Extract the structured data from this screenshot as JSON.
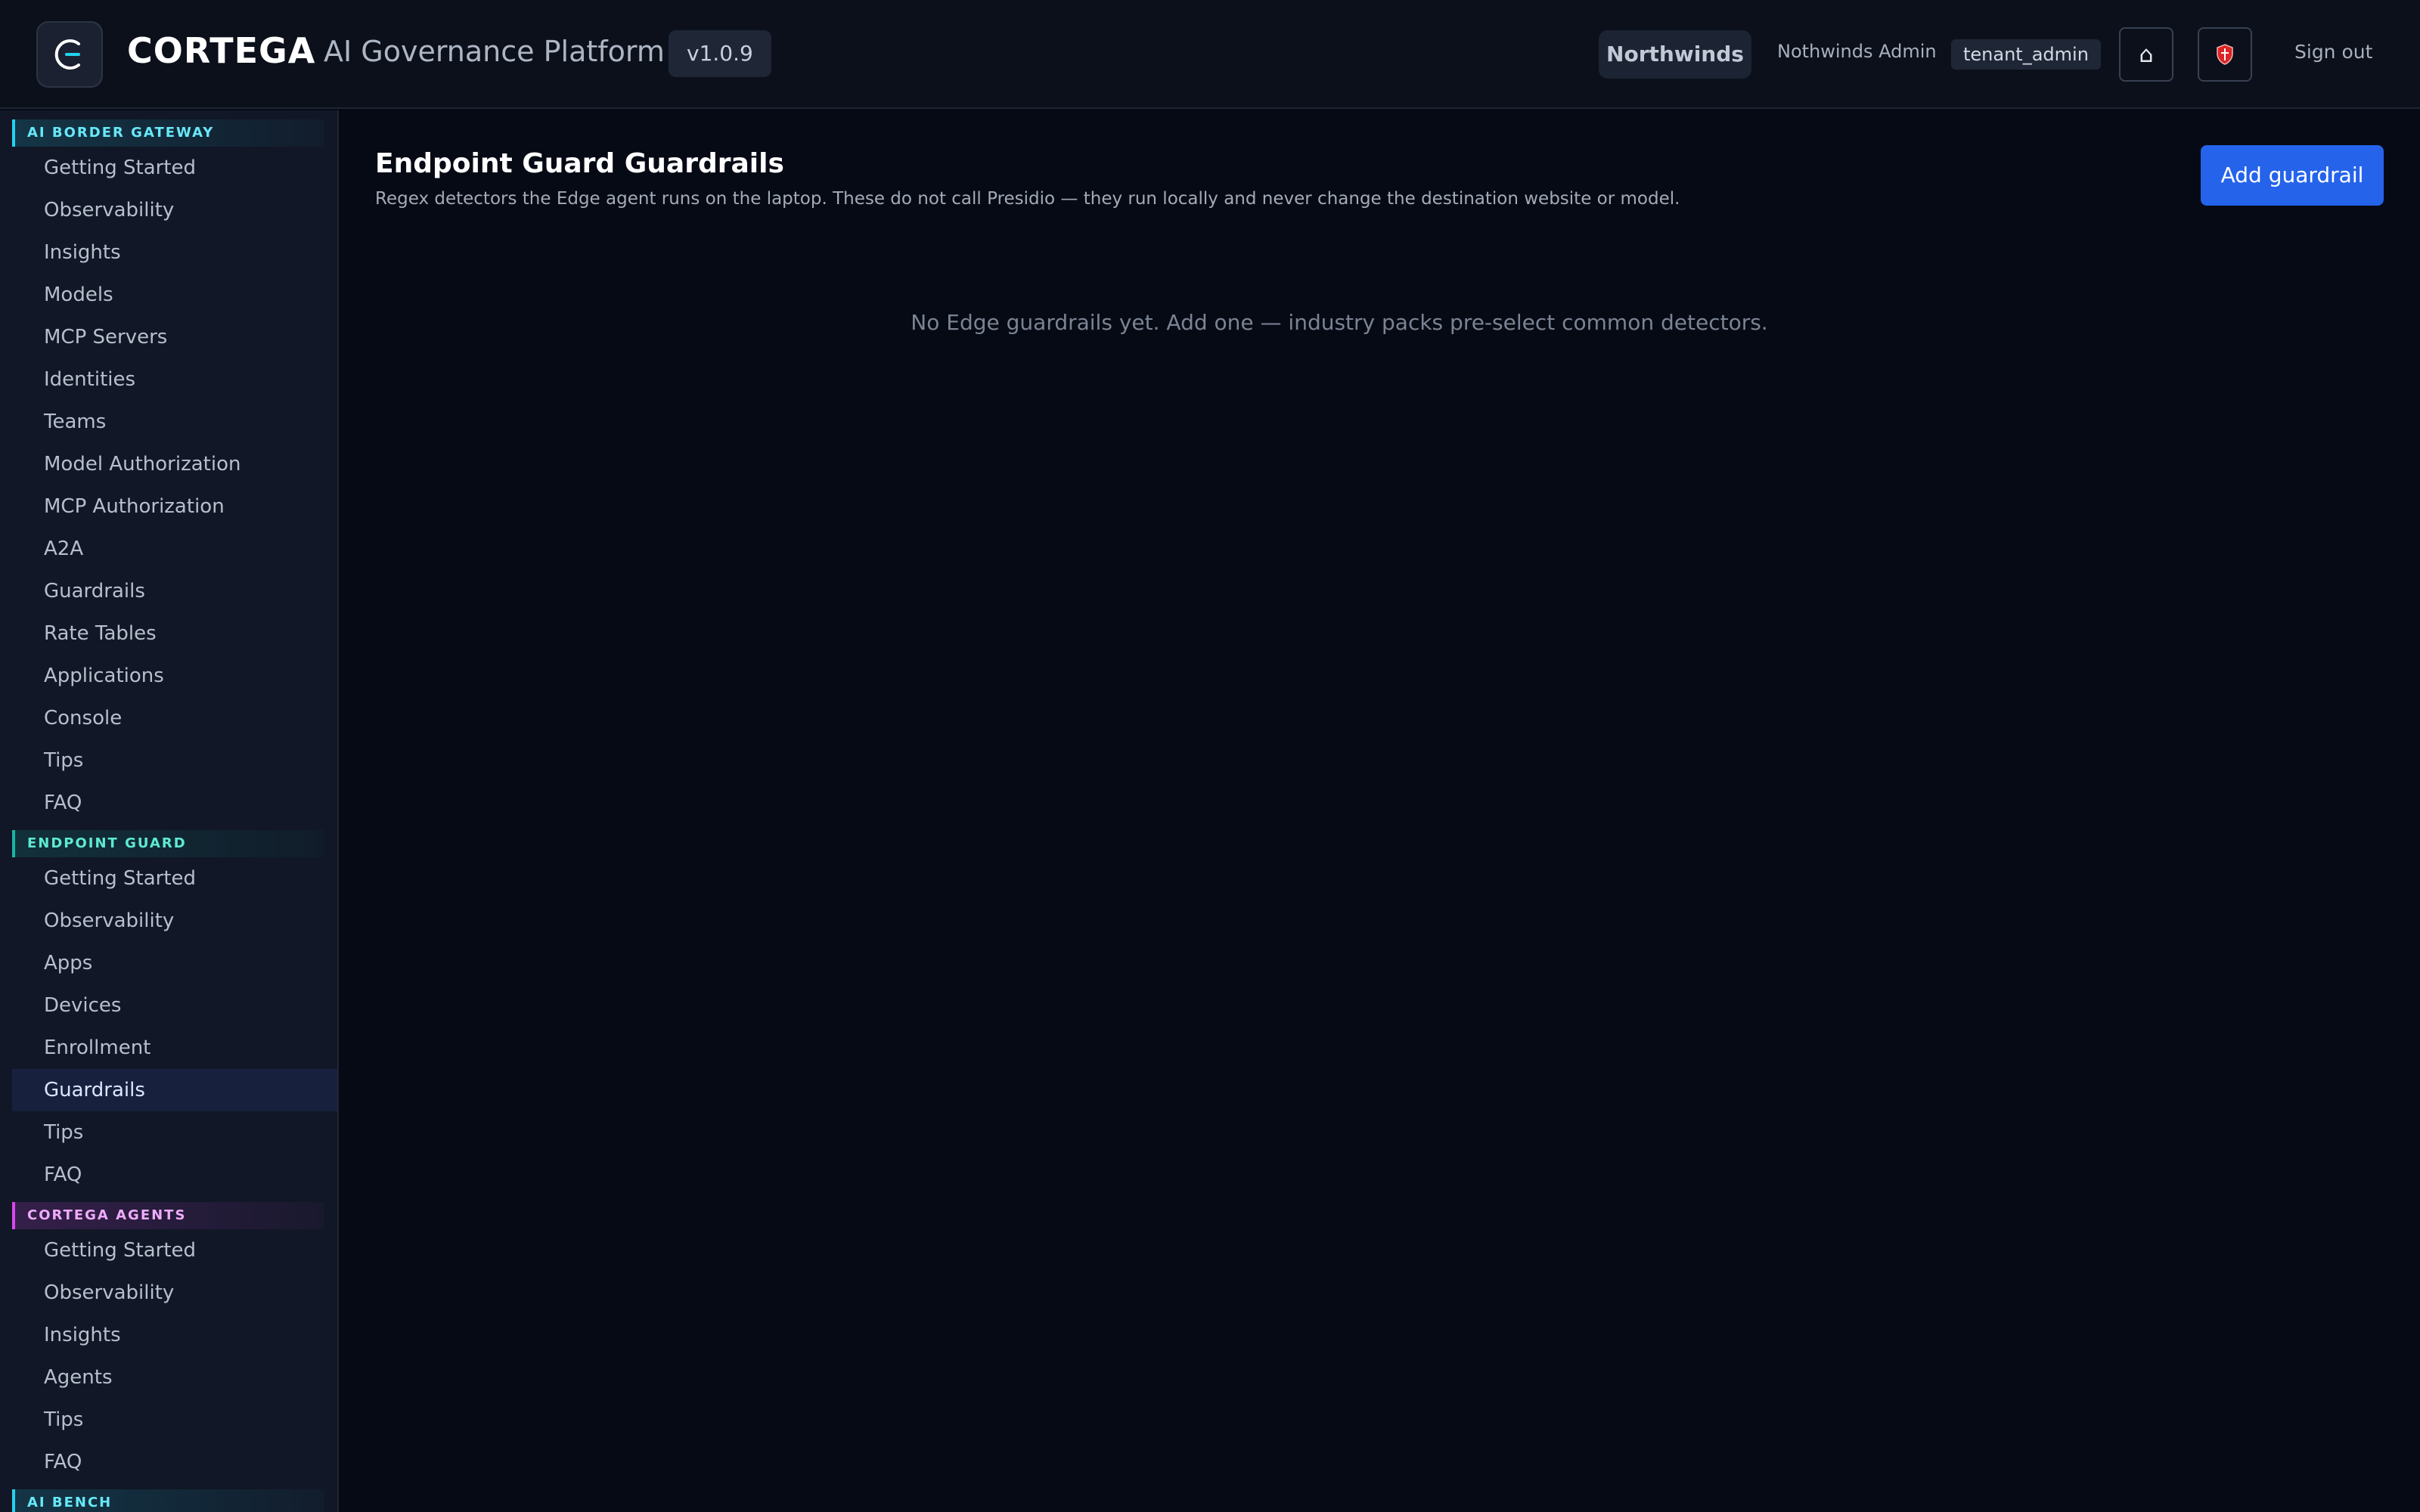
{
  "header": {
    "brand": "CORTEGA",
    "subtitle": "AI Governance Platform",
    "version": "v1.0.9",
    "tenant": "Northwinds",
    "user": "Nothwinds Admin",
    "role": "tenant_admin",
    "home_icon": "⌂",
    "sign_out": "Sign out"
  },
  "sidebar": {
    "sections": [
      {
        "title": "AI BORDER GATEWAY",
        "items": [
          "Getting Started",
          "Observability",
          "Insights",
          "Models",
          "MCP Servers",
          "Identities",
          "Teams",
          "Model Authorization",
          "MCP Authorization",
          "A2A",
          "Guardrails",
          "Rate Tables",
          "Applications",
          "Console",
          "Tips",
          "FAQ"
        ]
      },
      {
        "title": "ENDPOINT GUARD",
        "items": [
          "Getting Started",
          "Observability",
          "Apps",
          "Devices",
          "Enrollment",
          "Guardrails",
          "Tips",
          "FAQ"
        ]
      },
      {
        "title": "CORTEGA AGENTS",
        "items": [
          "Getting Started",
          "Observability",
          "Insights",
          "Agents",
          "Tips",
          "FAQ"
        ]
      },
      {
        "title": "AI BENCH",
        "items": []
      }
    ]
  },
  "main": {
    "title": "Endpoint Guard Guardrails",
    "description": "Regex detectors the Edge agent runs on the laptop. These do not call Presidio — they run locally and never change the destination website or model.",
    "add_button": "Add guardrail",
    "empty_message": "No Edge guardrails yet. Add one — industry packs pre-select common detectors."
  },
  "colors": {
    "accent": "#2563eb",
    "gateway": "#22d3ee",
    "endpoint": "#14b8a6",
    "agents": "#d946ef"
  }
}
